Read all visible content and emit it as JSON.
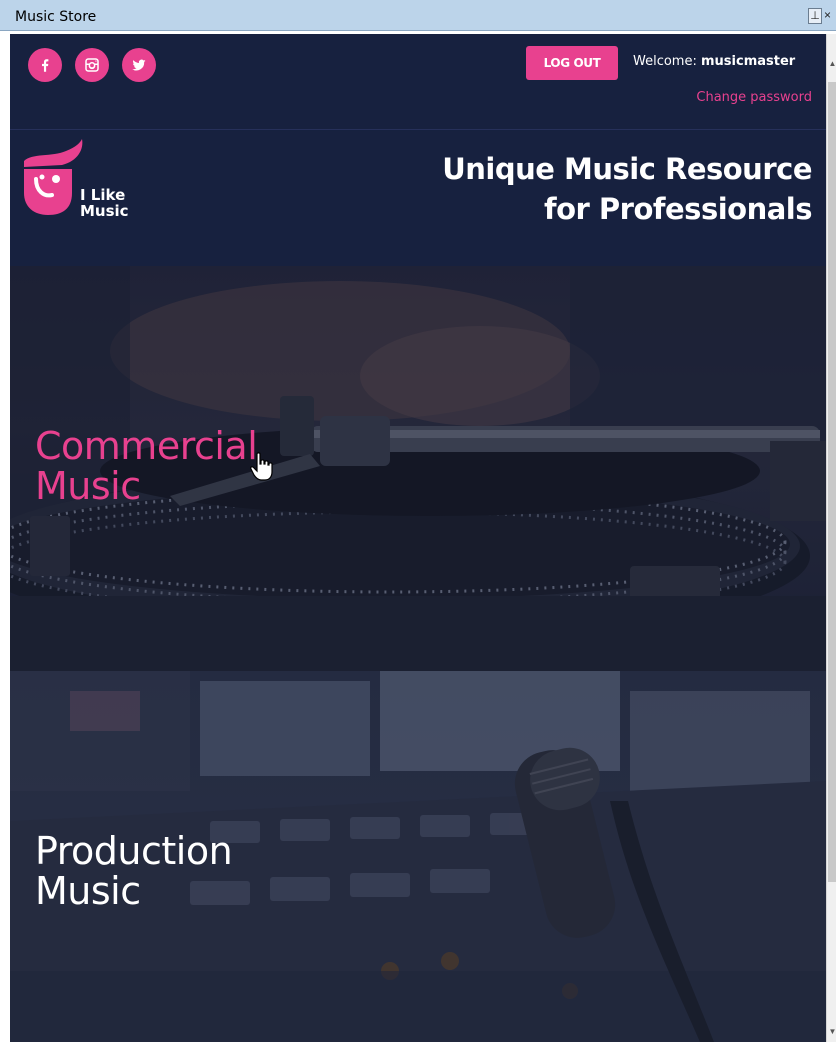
{
  "window": {
    "title": "Music Store",
    "pin_glyph": "⊥",
    "close_glyph": "×"
  },
  "topbar": {
    "social": [
      {
        "name": "facebook",
        "icon": "facebook-icon"
      },
      {
        "name": "instagram",
        "icon": "instagram-icon"
      },
      {
        "name": "twitter",
        "icon": "twitter-icon"
      }
    ],
    "logout_label": "LOG OUT",
    "welcome_prefix": "Welcome:",
    "username": "musicmaster",
    "change_password_label": "Change password"
  },
  "header": {
    "logo_line1": "I Like",
    "logo_line2": "Music",
    "tagline_line1": "Unique Music Resource",
    "tagline_line2": "for Professionals"
  },
  "panels": [
    {
      "line1": "Commercial",
      "line2": "Music"
    },
    {
      "line1": "Production",
      "line2": "Music"
    }
  ],
  "colors": {
    "accent": "#e8418f",
    "navy": "#17213f",
    "titlebar": "#bcd4ea"
  }
}
